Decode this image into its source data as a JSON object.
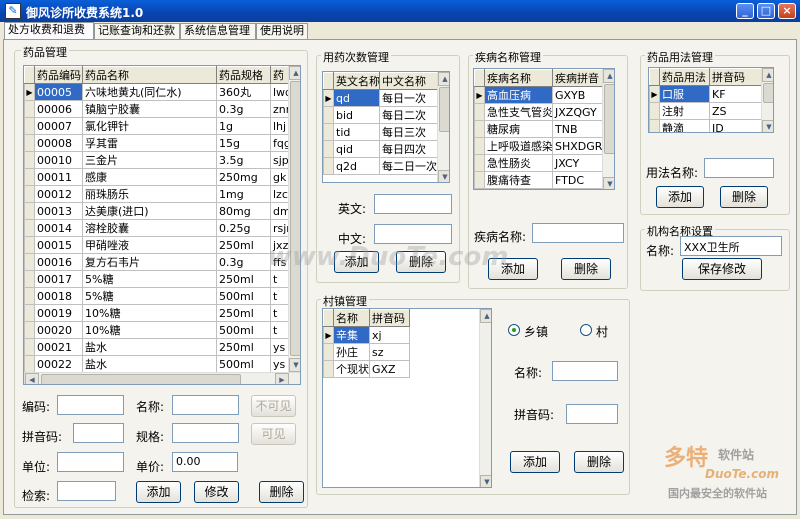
{
  "window": {
    "title": "御风诊所收费系统1.0"
  },
  "tabs": [
    "处方收费和退费",
    "记账查询和还款",
    "系统信息管理",
    "使用说明"
  ],
  "drugs": {
    "title": "药品管理",
    "columns": [
      "药品编码",
      "药品名称",
      "药品规格",
      "药"
    ],
    "rows": [
      [
        "00005",
        "六味地黄丸(同仁水)",
        "360丸",
        "lwd"
      ],
      [
        "00006",
        "镇脑宁胶囊",
        "0.3g",
        "znn"
      ],
      [
        "00007",
        "氯化钾针",
        "1g",
        "lhj"
      ],
      [
        "00008",
        "孚其雷",
        "15g",
        "fqg"
      ],
      [
        "00010",
        "三金片",
        "3.5g",
        "sjp"
      ],
      [
        "00011",
        "感康",
        "250mg",
        "gk"
      ],
      [
        "00012",
        "丽珠肠乐",
        "1mg",
        "lzc"
      ],
      [
        "00013",
        "达美康(进口)",
        "80mg",
        "dm"
      ],
      [
        "00014",
        "溶栓胶囊",
        "0.25g",
        "rsjn"
      ],
      [
        "00015",
        "甲硝唑液",
        "250ml",
        "jxz"
      ],
      [
        "00016",
        "复方石韦片",
        "0.3g",
        "ffs"
      ],
      [
        "00017",
        "5%糖",
        "250ml",
        "t"
      ],
      [
        "00018",
        "5%糖",
        "500ml",
        "t"
      ],
      [
        "00019",
        "10%糖",
        "250ml",
        "t"
      ],
      [
        "00020",
        "10%糖",
        "500ml",
        "t"
      ],
      [
        "00021",
        "盐水",
        "250ml",
        "ys"
      ],
      [
        "00022",
        "盐水",
        "500ml",
        "ys"
      ]
    ],
    "form": {
      "code_label": "编码:",
      "name_label": "名称:",
      "pinyin_label": "拼音码:",
      "spec_label": "规格:",
      "unit_label": "单位:",
      "price_label": "单价:",
      "price_value": "0.00",
      "search_label": "检索:"
    },
    "buttons": {
      "invisible": "不可见",
      "visible": "可见",
      "add": "添加",
      "edit": "修改",
      "delete": "删除"
    }
  },
  "freq": {
    "title": "用药次数管理",
    "columns": [
      "英文名称",
      "中文名称"
    ],
    "rows": [
      [
        "qd",
        "每日一次"
      ],
      [
        "bid",
        "每日二次"
      ],
      [
        "tid",
        "每日三次"
      ],
      [
        "qid",
        "每日四次"
      ],
      [
        "q2d",
        "每二日一次"
      ]
    ],
    "en_label": "英文:",
    "cn_label": "中文:",
    "add": "添加",
    "delete": "删除"
  },
  "disease": {
    "title": "疾病名称管理",
    "columns": [
      "疾病名称",
      "疾病拼音"
    ],
    "rows": [
      [
        "高血压病",
        "GXYB"
      ],
      [
        "急性支气管炎",
        "JXZQGY"
      ],
      [
        "糖尿病",
        "TNB"
      ],
      [
        "上呼吸道感染",
        "SHXDGR"
      ],
      [
        "急性肠炎",
        "JXCY"
      ],
      [
        "腹痛待查",
        "FTDC"
      ]
    ],
    "name_label": "疾病名称:",
    "add": "添加",
    "delete": "删除"
  },
  "usage": {
    "title": "药品用法管理",
    "columns": [
      "药品用法",
      "拼音码"
    ],
    "rows": [
      [
        "口服",
        "KF"
      ],
      [
        "注射",
        "ZS"
      ],
      [
        "静滴",
        "JD"
      ]
    ],
    "name_label": "用法名称:",
    "add": "添加",
    "delete": "删除"
  },
  "org": {
    "title": "机构名称设置",
    "name_label": "名称:",
    "name_value": "XXX卫生所",
    "save": "保存修改"
  },
  "village": {
    "title": "村镇管理",
    "columns": [
      "名称",
      "拼音码"
    ],
    "rows": [
      [
        "辛集",
        "xj"
      ],
      [
        "孙庄",
        "sz"
      ],
      [
        "个现状",
        "GXZ"
      ]
    ],
    "radio_town": "乡镇",
    "radio_village": "村",
    "name_label": "名称:",
    "pinyin_label": "拼音码:",
    "add": "添加",
    "delete": "删除"
  },
  "watermark": {
    "center": "www.DuoTe.com",
    "brand": "多特",
    "brand_sub": "软件站",
    "brand_url": "DuoTe.com",
    "brand_slogan": "国内最安全的软件站"
  }
}
